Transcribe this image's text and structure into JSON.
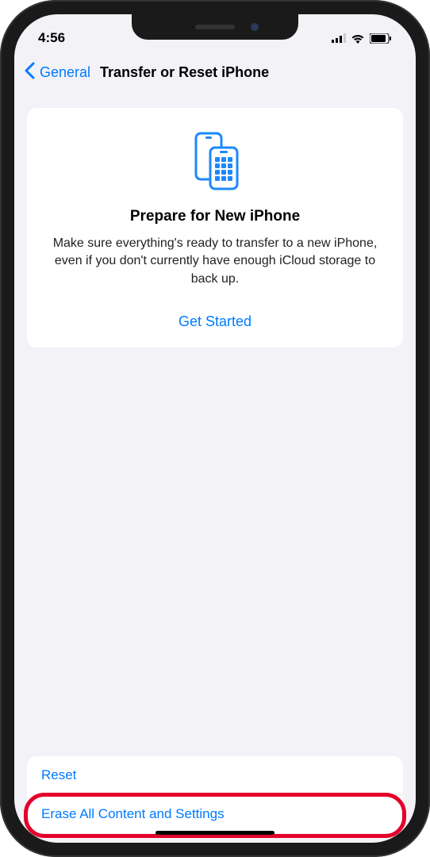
{
  "status": {
    "time": "4:56"
  },
  "nav": {
    "back_label": "General",
    "title": "Transfer or Reset iPhone"
  },
  "card": {
    "title": "Prepare for New iPhone",
    "description": "Make sure everything's ready to transfer to a new iPhone, even if you don't currently have enough iCloud storage to back up.",
    "action": "Get Started"
  },
  "list": {
    "reset_label": "Reset",
    "erase_label": "Erase All Content and Settings"
  }
}
